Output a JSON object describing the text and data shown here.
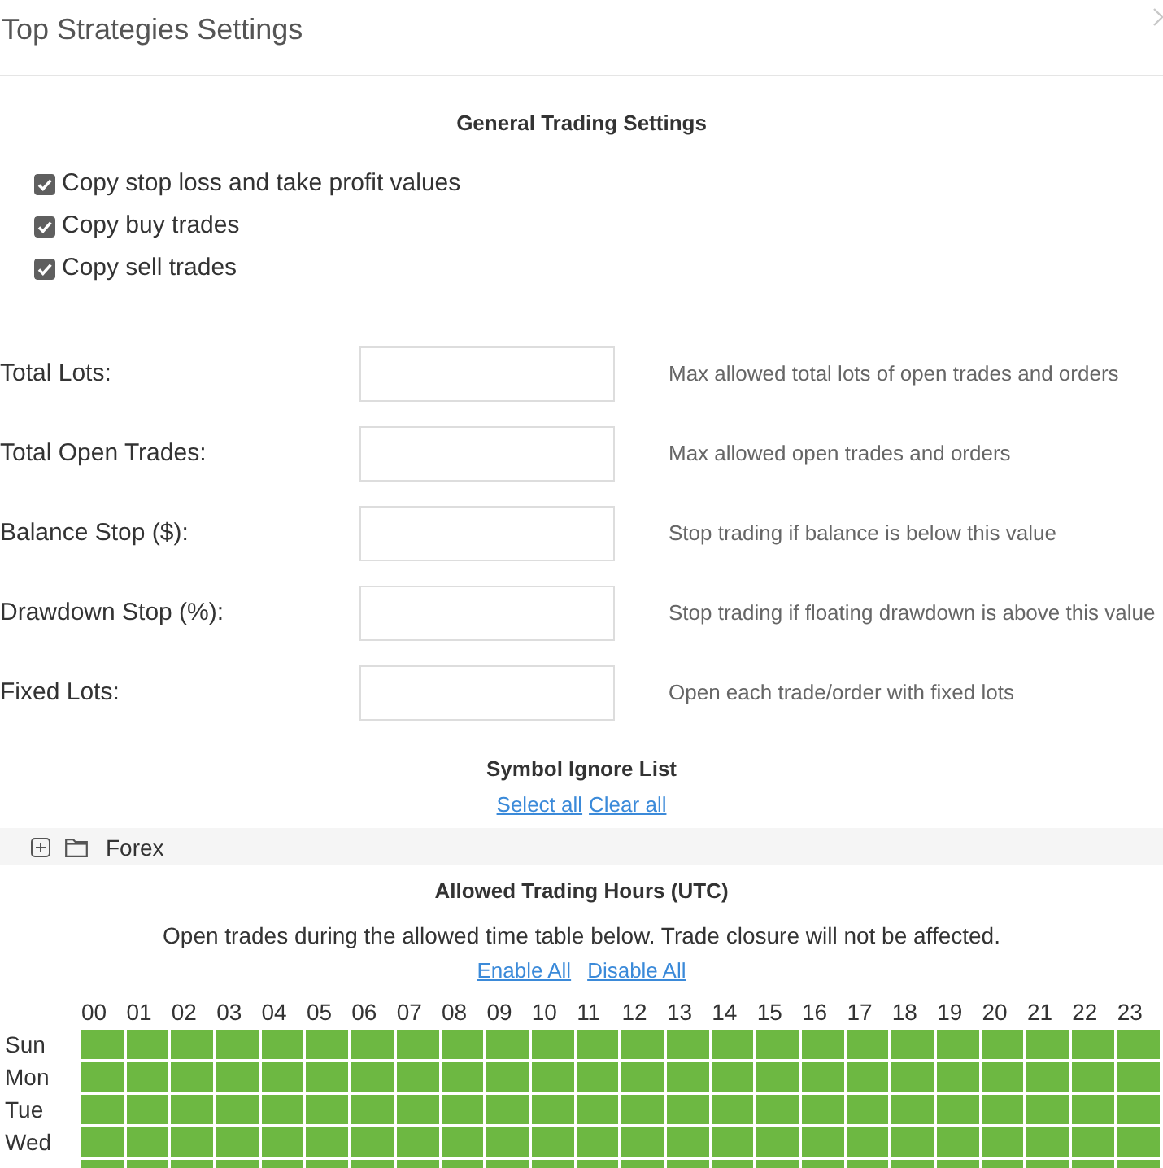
{
  "window": {
    "title": "Top Strategies Settings"
  },
  "general": {
    "heading": "General Trading Settings",
    "options": [
      {
        "label": "Copy stop loss and take profit values",
        "checked": true
      },
      {
        "label": "Copy buy trades",
        "checked": true
      },
      {
        "label": "Copy sell trades",
        "checked": true
      }
    ]
  },
  "limits": [
    {
      "label": "Total Lots:",
      "description": "Max allowed total lots of open trades and orders"
    },
    {
      "label": "Total Open Trades:",
      "description": "Max allowed open trades and orders"
    },
    {
      "label": "Balance Stop ($):",
      "description": "Stop trading if balance is below this value"
    },
    {
      "label": "Drawdown Stop (%):",
      "description": "Stop trading if floating drawdown is above this value"
    },
    {
      "label": "Fixed Lots:",
      "description": "Open each trade/order with fixed lots"
    }
  ],
  "symbol_ignore": {
    "heading": "Symbol Ignore List",
    "links": [
      "Select all",
      "Clear all"
    ],
    "tree": [
      {
        "label": "Forex",
        "expanded": false
      }
    ]
  },
  "trading_hours": {
    "heading": "Allowed Trading Hours (UTC)",
    "note": "Open trades during the allowed time table below. Trade closure will not be affected.",
    "links": [
      "Enable All",
      "Disable All"
    ],
    "hours": [
      "00",
      "01",
      "02",
      "03",
      "04",
      "05",
      "06",
      "07",
      "08",
      "09",
      "10",
      "11",
      "12",
      "13",
      "14",
      "15",
      "16",
      "17",
      "18",
      "19",
      "20",
      "21",
      "22",
      "23"
    ],
    "days": [
      {
        "label": "Sun",
        "enabled": [
          true,
          true,
          true,
          true,
          true,
          true,
          true,
          true,
          true,
          true,
          true,
          true,
          true,
          true,
          true,
          true,
          true,
          true,
          true,
          true,
          true,
          true,
          true,
          true
        ]
      },
      {
        "label": "Mon",
        "enabled": [
          true,
          true,
          true,
          true,
          true,
          true,
          true,
          true,
          true,
          true,
          true,
          true,
          true,
          true,
          true,
          true,
          true,
          true,
          true,
          true,
          true,
          true,
          true,
          true
        ]
      },
      {
        "label": "Tue",
        "enabled": [
          true,
          true,
          true,
          true,
          true,
          true,
          true,
          true,
          true,
          true,
          true,
          true,
          true,
          true,
          true,
          true,
          true,
          true,
          true,
          true,
          true,
          true,
          true,
          true
        ]
      },
      {
        "label": "Wed",
        "enabled": [
          true,
          true,
          true,
          true,
          true,
          true,
          true,
          true,
          true,
          true,
          true,
          true,
          true,
          true,
          true,
          true,
          true,
          true,
          true,
          true,
          true,
          true,
          true,
          true
        ]
      },
      {
        "enabled": [
          true,
          true,
          true,
          true,
          true,
          true,
          true,
          true,
          true,
          true,
          true,
          true,
          true,
          true,
          true,
          true,
          true,
          true,
          true,
          true,
          true,
          true,
          true,
          true
        ]
      }
    ]
  }
}
